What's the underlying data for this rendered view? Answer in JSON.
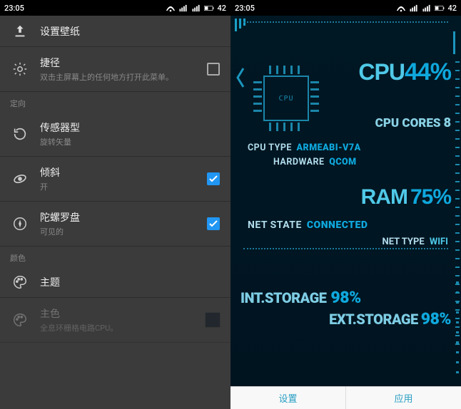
{
  "statusbar": {
    "time": "23:05",
    "battery": "42"
  },
  "left": {
    "set_wallpaper": "设置壁纸",
    "shortcut": {
      "title": "捷径",
      "sub": "双击主屏幕上的任何地方打开此菜单。"
    },
    "section_orientation": "定向",
    "sensor": {
      "title": "传感器型",
      "sub": "旋转矢量"
    },
    "tilt": {
      "title": "倾斜",
      "sub": "开"
    },
    "gyro": {
      "title": "陀螺罗盘",
      "sub": "可见的"
    },
    "section_color": "颜色",
    "theme": {
      "title": "主题"
    },
    "primary": {
      "title": "主色",
      "sub": "全息环栅格电路CPU。"
    }
  },
  "right": {
    "cpu": {
      "label": "CPU",
      "value": "44%"
    },
    "cores": {
      "label": "CPU CORES",
      "value": "8"
    },
    "cpu_type": {
      "label": "CPU TYPE",
      "value": "ARMEABI-V7A"
    },
    "hardware": {
      "label": "HARDWARE",
      "value": "QCOM"
    },
    "ram": {
      "label": "RAM",
      "value": "75%"
    },
    "netstate": {
      "label": "NET STATE",
      "value": "CONNECTED"
    },
    "nettype": {
      "label": "NET TYPE",
      "value": "WIFI"
    },
    "intstor": {
      "label": "INT.STORAGE",
      "value": "98%"
    },
    "extstor": {
      "label": "EXT.STORAGE",
      "value": "98%"
    },
    "btn_settings": "设置",
    "btn_apply": "应用"
  }
}
